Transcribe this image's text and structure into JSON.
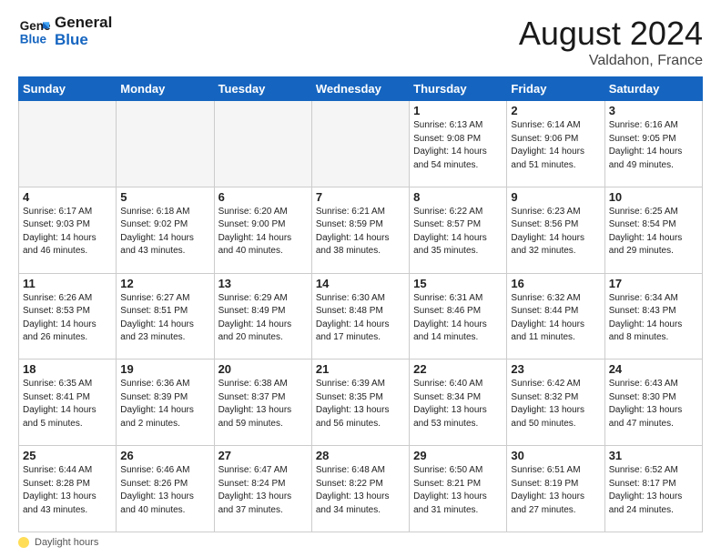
{
  "logo": {
    "line1": "General",
    "line2": "Blue"
  },
  "title": "August 2024",
  "location": "Valdahon, France",
  "days_of_week": [
    "Sunday",
    "Monday",
    "Tuesday",
    "Wednesday",
    "Thursday",
    "Friday",
    "Saturday"
  ],
  "footer_label": "Daylight hours",
  "weeks": [
    [
      {
        "day": "",
        "info": ""
      },
      {
        "day": "",
        "info": ""
      },
      {
        "day": "",
        "info": ""
      },
      {
        "day": "",
        "info": ""
      },
      {
        "day": "1",
        "info": "Sunrise: 6:13 AM\nSunset: 9:08 PM\nDaylight: 14 hours\nand 54 minutes."
      },
      {
        "day": "2",
        "info": "Sunrise: 6:14 AM\nSunset: 9:06 PM\nDaylight: 14 hours\nand 51 minutes."
      },
      {
        "day": "3",
        "info": "Sunrise: 6:16 AM\nSunset: 9:05 PM\nDaylight: 14 hours\nand 49 minutes."
      }
    ],
    [
      {
        "day": "4",
        "info": "Sunrise: 6:17 AM\nSunset: 9:03 PM\nDaylight: 14 hours\nand 46 minutes."
      },
      {
        "day": "5",
        "info": "Sunrise: 6:18 AM\nSunset: 9:02 PM\nDaylight: 14 hours\nand 43 minutes."
      },
      {
        "day": "6",
        "info": "Sunrise: 6:20 AM\nSunset: 9:00 PM\nDaylight: 14 hours\nand 40 minutes."
      },
      {
        "day": "7",
        "info": "Sunrise: 6:21 AM\nSunset: 8:59 PM\nDaylight: 14 hours\nand 38 minutes."
      },
      {
        "day": "8",
        "info": "Sunrise: 6:22 AM\nSunset: 8:57 PM\nDaylight: 14 hours\nand 35 minutes."
      },
      {
        "day": "9",
        "info": "Sunrise: 6:23 AM\nSunset: 8:56 PM\nDaylight: 14 hours\nand 32 minutes."
      },
      {
        "day": "10",
        "info": "Sunrise: 6:25 AM\nSunset: 8:54 PM\nDaylight: 14 hours\nand 29 minutes."
      }
    ],
    [
      {
        "day": "11",
        "info": "Sunrise: 6:26 AM\nSunset: 8:53 PM\nDaylight: 14 hours\nand 26 minutes."
      },
      {
        "day": "12",
        "info": "Sunrise: 6:27 AM\nSunset: 8:51 PM\nDaylight: 14 hours\nand 23 minutes."
      },
      {
        "day": "13",
        "info": "Sunrise: 6:29 AM\nSunset: 8:49 PM\nDaylight: 14 hours\nand 20 minutes."
      },
      {
        "day": "14",
        "info": "Sunrise: 6:30 AM\nSunset: 8:48 PM\nDaylight: 14 hours\nand 17 minutes."
      },
      {
        "day": "15",
        "info": "Sunrise: 6:31 AM\nSunset: 8:46 PM\nDaylight: 14 hours\nand 14 minutes."
      },
      {
        "day": "16",
        "info": "Sunrise: 6:32 AM\nSunset: 8:44 PM\nDaylight: 14 hours\nand 11 minutes."
      },
      {
        "day": "17",
        "info": "Sunrise: 6:34 AM\nSunset: 8:43 PM\nDaylight: 14 hours\nand 8 minutes."
      }
    ],
    [
      {
        "day": "18",
        "info": "Sunrise: 6:35 AM\nSunset: 8:41 PM\nDaylight: 14 hours\nand 5 minutes."
      },
      {
        "day": "19",
        "info": "Sunrise: 6:36 AM\nSunset: 8:39 PM\nDaylight: 14 hours\nand 2 minutes."
      },
      {
        "day": "20",
        "info": "Sunrise: 6:38 AM\nSunset: 8:37 PM\nDaylight: 13 hours\nand 59 minutes."
      },
      {
        "day": "21",
        "info": "Sunrise: 6:39 AM\nSunset: 8:35 PM\nDaylight: 13 hours\nand 56 minutes."
      },
      {
        "day": "22",
        "info": "Sunrise: 6:40 AM\nSunset: 8:34 PM\nDaylight: 13 hours\nand 53 minutes."
      },
      {
        "day": "23",
        "info": "Sunrise: 6:42 AM\nSunset: 8:32 PM\nDaylight: 13 hours\nand 50 minutes."
      },
      {
        "day": "24",
        "info": "Sunrise: 6:43 AM\nSunset: 8:30 PM\nDaylight: 13 hours\nand 47 minutes."
      }
    ],
    [
      {
        "day": "25",
        "info": "Sunrise: 6:44 AM\nSunset: 8:28 PM\nDaylight: 13 hours\nand 43 minutes."
      },
      {
        "day": "26",
        "info": "Sunrise: 6:46 AM\nSunset: 8:26 PM\nDaylight: 13 hours\nand 40 minutes."
      },
      {
        "day": "27",
        "info": "Sunrise: 6:47 AM\nSunset: 8:24 PM\nDaylight: 13 hours\nand 37 minutes."
      },
      {
        "day": "28",
        "info": "Sunrise: 6:48 AM\nSunset: 8:22 PM\nDaylight: 13 hours\nand 34 minutes."
      },
      {
        "day": "29",
        "info": "Sunrise: 6:50 AM\nSunset: 8:21 PM\nDaylight: 13 hours\nand 31 minutes."
      },
      {
        "day": "30",
        "info": "Sunrise: 6:51 AM\nSunset: 8:19 PM\nDaylight: 13 hours\nand 27 minutes."
      },
      {
        "day": "31",
        "info": "Sunrise: 6:52 AM\nSunset: 8:17 PM\nDaylight: 13 hours\nand 24 minutes."
      }
    ]
  ]
}
